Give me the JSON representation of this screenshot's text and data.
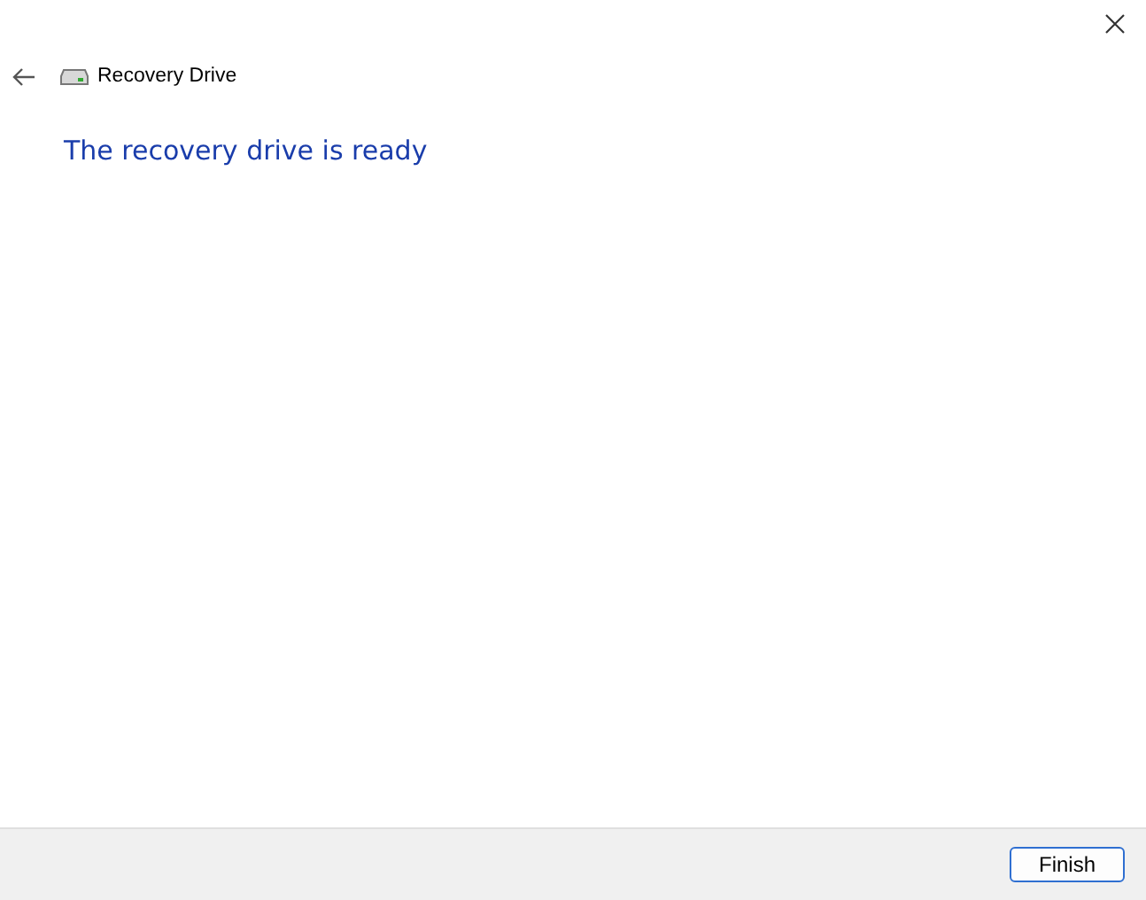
{
  "window": {
    "title": "Recovery Drive"
  },
  "heading": "The recovery drive is ready",
  "buttons": [
    {
      "label": "Finish",
      "default": true
    }
  ]
}
